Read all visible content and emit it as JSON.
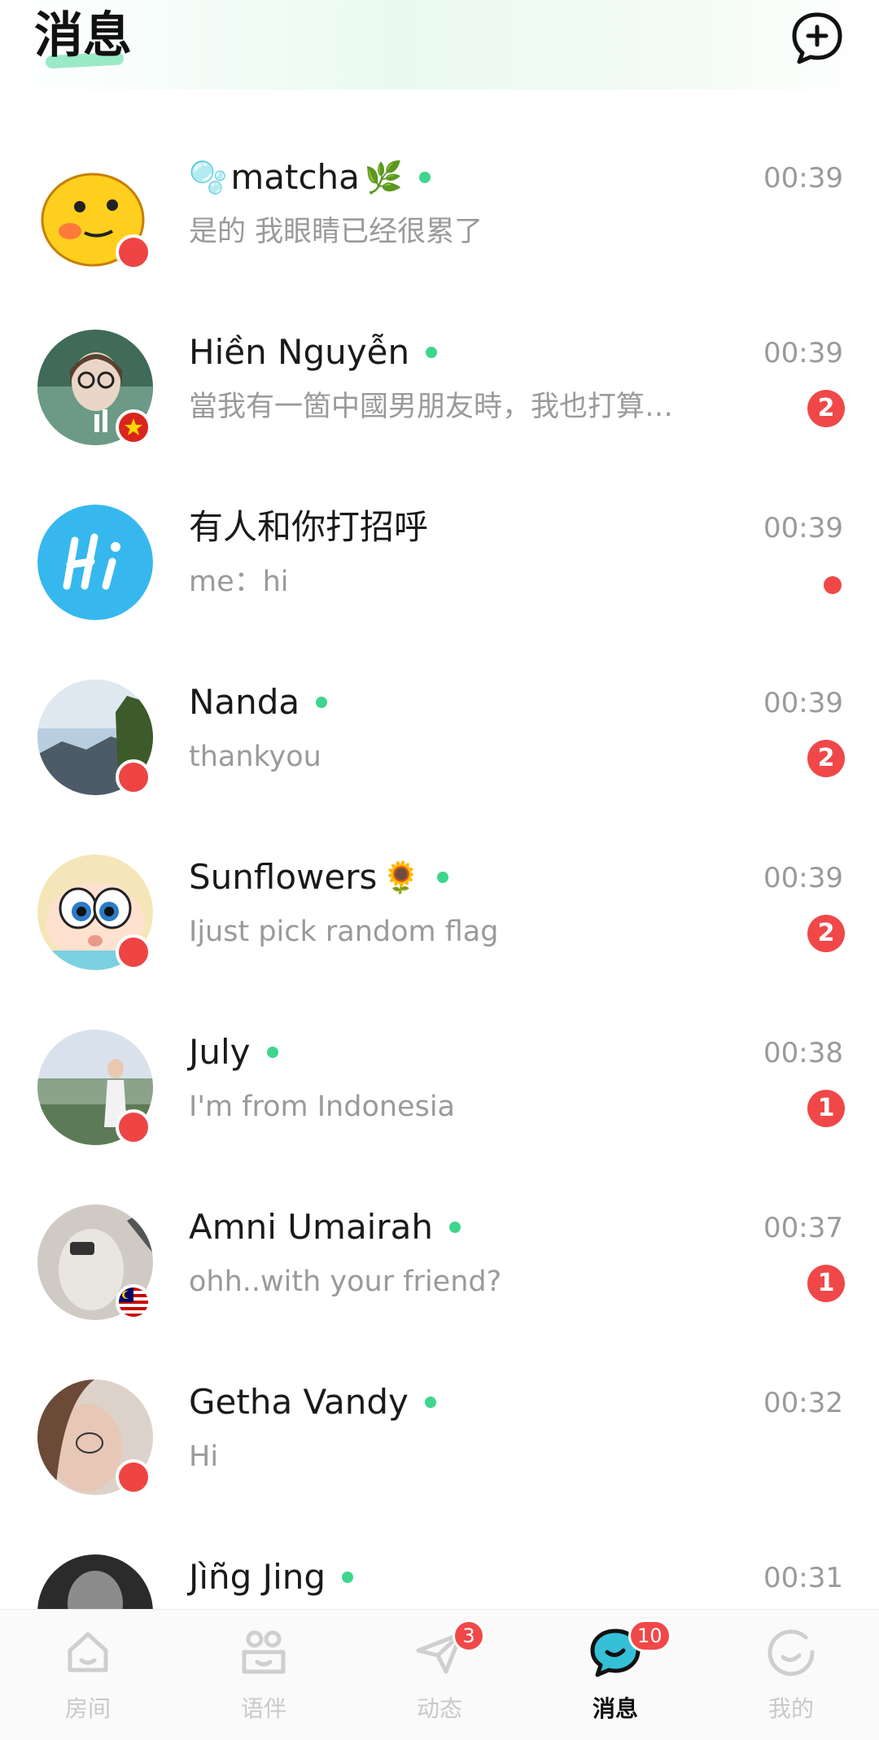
{
  "header": {
    "title": "消息"
  },
  "conversations": [
    {
      "name": "matcha",
      "prefix_emoji": "🫧",
      "suffix_emoji": "🌿",
      "preview": "是的 我眼睛已经很累了",
      "time": "00:39",
      "unread": "",
      "online": true
    },
    {
      "name": "Hiền Nguyễn",
      "prefix_emoji": "",
      "suffix_emoji": "",
      "preview": "當我有一箇中國男朋友時，我也打算…",
      "time": "00:39",
      "unread": "2",
      "online": true
    },
    {
      "name": "有人和你打招呼",
      "prefix_emoji": "",
      "suffix_emoji": "",
      "preview": "me：hi",
      "time": "00:39",
      "unread": "",
      "online": false,
      "unread_dot": true
    },
    {
      "name": "Nanda",
      "prefix_emoji": "",
      "suffix_emoji": "",
      "preview": "thankyou",
      "time": "00:39",
      "unread": "2",
      "online": true
    },
    {
      "name": "Sunflowers",
      "prefix_emoji": "",
      "suffix_emoji": "🌻",
      "preview": "Ijust pick random flag",
      "time": "00:39",
      "unread": "2",
      "online": true
    },
    {
      "name": "July",
      "prefix_emoji": "",
      "suffix_emoji": "",
      "preview": "I'm from Indonesia",
      "time": "00:38",
      "unread": "1",
      "online": true
    },
    {
      "name": "Amni Umairah",
      "prefix_emoji": "",
      "suffix_emoji": "",
      "preview": "ohh..with your friend?",
      "time": "00:37",
      "unread": "1",
      "online": true
    },
    {
      "name": "Getha Vandy",
      "prefix_emoji": "",
      "suffix_emoji": "",
      "preview": "Hi",
      "time": "00:32",
      "unread": "",
      "online": true
    },
    {
      "name": "Jìñg Jing",
      "prefix_emoji": "",
      "suffix_emoji": "",
      "preview": "",
      "time": "00:31",
      "unread": "",
      "online": true
    }
  ],
  "tabs": [
    {
      "label": "房间",
      "icon": "room-icon",
      "badge": ""
    },
    {
      "label": "语伴",
      "icon": "partners-icon",
      "badge": ""
    },
    {
      "label": "动态",
      "icon": "moments-icon",
      "badge": "3"
    },
    {
      "label": "消息",
      "icon": "messages-icon",
      "badge": "10"
    },
    {
      "label": "我的",
      "icon": "profile-icon",
      "badge": ""
    }
  ],
  "colors": {
    "accent": "#3dd68c",
    "badge": "#f04848",
    "muted": "#9a9a9a"
  }
}
